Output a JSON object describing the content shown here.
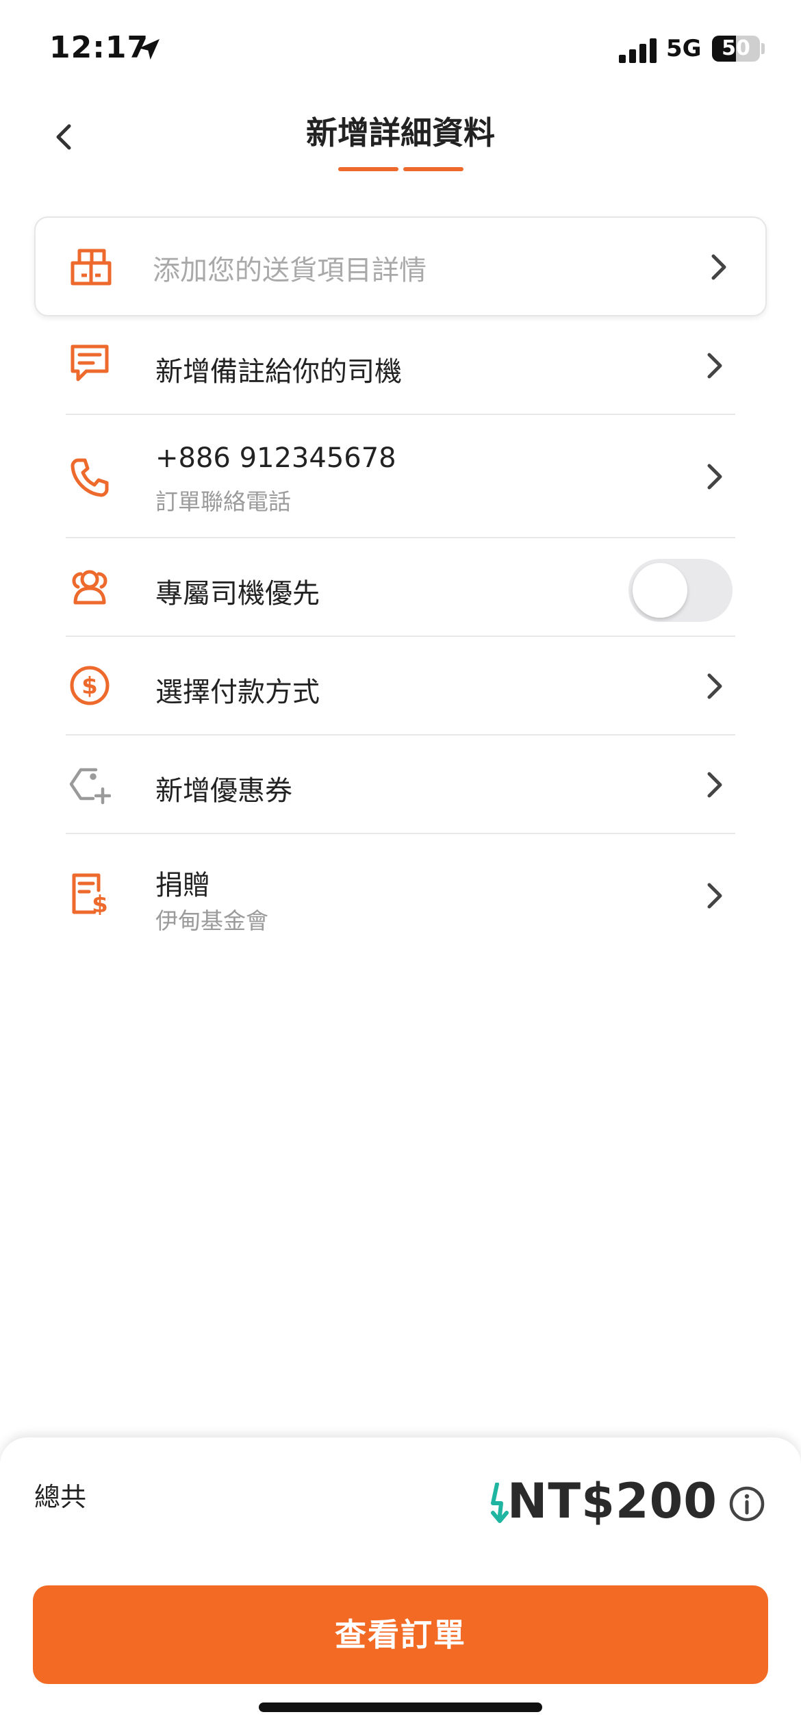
{
  "status_bar": {
    "time": "12:17",
    "location_icon": "location-arrow-icon",
    "signal_icon": "signal-bars-icon",
    "network": "5G",
    "battery": "50",
    "battery_fraction": 0.5
  },
  "header": {
    "back_icon": "chevron-left-icon",
    "title": "新增詳細資料",
    "progress_steps": 2,
    "accent_color": "#EE6A2C"
  },
  "item_details": {
    "icon": "boxes-icon",
    "placeholder": "添加您的送貨項目詳情",
    "chevron_icon": "chevron-right-icon"
  },
  "rows": [
    {
      "id": "driver-note",
      "icon": "message-icon",
      "title": "新增備註給你的司機",
      "subtitle": ""
    },
    {
      "id": "phone",
      "icon": "phone-icon",
      "title": "+886 912345678",
      "subtitle": "訂單聯絡電話"
    },
    {
      "id": "dedicated-driver",
      "icon": "people-icon",
      "title": "專屬司機優先",
      "subtitle": "",
      "toggle": false
    },
    {
      "id": "payment-method",
      "icon": "dollar-coin-icon",
      "title": "選擇付款方式",
      "subtitle": ""
    },
    {
      "id": "coupon",
      "icon": "tag-plus-icon",
      "title": "新增優惠券",
      "subtitle": ""
    },
    {
      "id": "donation",
      "icon": "donation-doc-icon",
      "title": "捐贈",
      "subtitle": "伊甸基金會"
    }
  ],
  "footer": {
    "total_label": "總共",
    "lightning_icon": "lightning-icon",
    "price": "NT$200",
    "info_icon": "info-icon",
    "cta_label": "查看訂單",
    "cta_color": "#F26A24"
  }
}
